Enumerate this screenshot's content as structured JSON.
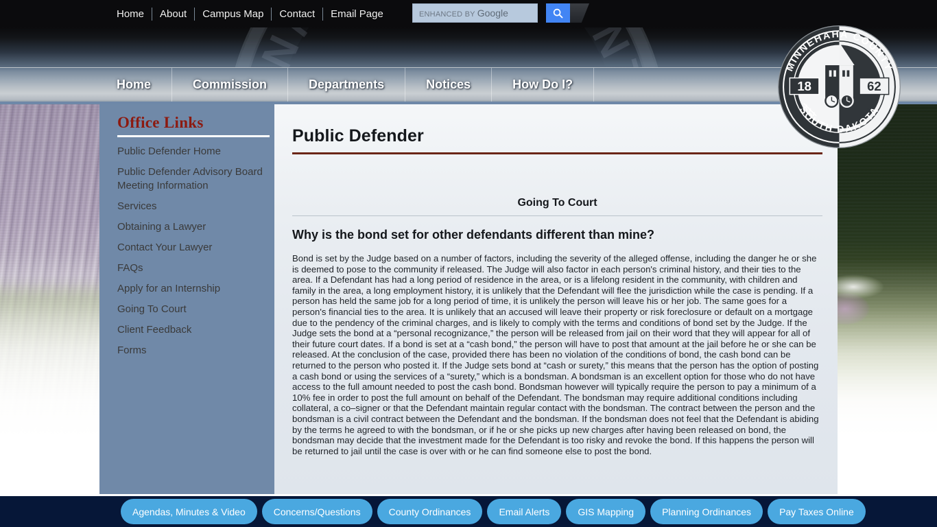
{
  "topbar": {
    "links": [
      "Home",
      "About",
      "Campus Map",
      "Contact",
      "Email Page"
    ],
    "search": {
      "placeholder_small": "ENHANCED BY",
      "placeholder_brand": "Google",
      "button_icon": "search-icon"
    }
  },
  "mainnav": {
    "items": [
      "Home",
      "Commission",
      "Departments",
      "Notices",
      "How Do I?"
    ]
  },
  "seal": {
    "top_text": "MINNEHAHA COUNTY",
    "bottom_text": "SOUTH DAKOTA",
    "year_left": "18",
    "year_right": "62"
  },
  "watermark": {
    "text": "MINNEHAHA COUNTY"
  },
  "sidebar": {
    "title": "Office Links",
    "links": [
      "Public Defender Home",
      "Public Defender Advisory Board Meeting Information",
      "Services",
      "Obtaining a Lawyer",
      "Contact Your Lawyer",
      "FAQs",
      "Apply for an Internship",
      "Going To Court",
      "Client Feedback",
      "Forms"
    ]
  },
  "content": {
    "page_title": "Public Defender",
    "section_heading": "Going To Court",
    "question": "Why is the bond set for other defendants different than mine?",
    "body": "Bond is set by the Judge based on a number of factors, including the severity of the alleged offense, including the danger he or she is deemed to pose to the community if released.  The Judge will also factor in each person's criminal history, and their ties to the area.   If a Defendant has had a long period of residence in the area, or is a lifelong resident in the community, with children and family in the area, a long employment history, it is unlikely that the Defendant will flee the jurisdiction while the case is pending.  If a person has held the same job for a long period of time, it is unlikely the person will leave his or her job.  The same goes for a person's financial ties to the area.  It is unlikely that an accused will leave their property or risk foreclosure or default on a mortgage due to the pendency of the criminal charges, and is likely to comply with the terms and conditions of bond set by the Judge.   If the Judge sets the bond at a “personal recognizance,” the person will be released from jail on their word that they will appear for all of their future court dates.  If a bond is set at a “cash bond,” the person will have to post that amount at the jail before he or she can be released.  At the conclusion of the case, provided there has been no violation of the conditions of bond, the cash bond can be returned to the person who posted it.  If the Judge sets bond at “cash or surety,” this means that the person has the option of posting a cash bond or using the services of a “surety,” which is a bondsman.  A bondsman is an excellent option for those who do not have access to the full amount needed to post the cash bond.  Bondsman however will typically require the person to pay a minimum of a 10% fee in order to post the full amount on behalf of the Defendant.  The bondsman may require additional conditions including collateral, a co–signer or that the Defendant maintain regular contact with the bondsman.    The contract between the person and the bondsman is a civil contract between the Defendant and the bondsman.  If the bondsman does not feel that the Defendant is abiding by the terms he agreed to with the bondsman, or if he or she picks up new charges after having been released on bond, the bondsman may decide that the investment made for the Defendant is too risky and revoke the bond.  If this happens the person will be returned to jail until the case is over with or he can find someone else to post the bond."
  },
  "footer": {
    "buttons": [
      "Agendas, Minutes & Video",
      "Concerns/Questions",
      "County Ordinances",
      "Email Alerts",
      "GIS Mapping",
      "Planning Ordinances",
      "Pay Taxes Online"
    ]
  },
  "colors": {
    "sidebar_bg": "#7089a8",
    "sidebar_title": "#8c1a10",
    "title_rule": "#6b2617",
    "footer_bg": "#061738",
    "footer_button": "#4aa8e0",
    "google_blue": "#4285f4"
  }
}
